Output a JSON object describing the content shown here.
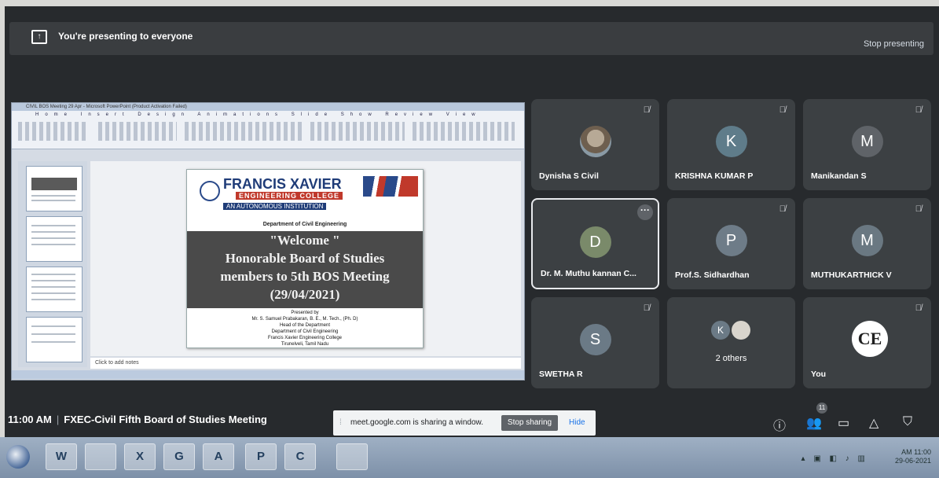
{
  "banner": {
    "presenting_text": "You're presenting to everyone",
    "stop_label": "Stop presenting"
  },
  "shared_window": {
    "title": "CIVIL BOS Meeting 29 Apr - Microsoft PowerPoint (Product Activation Failed)",
    "tabs": "Home Insert Design Animations Slide Show Review View",
    "notes_placeholder": "Click to add notes",
    "slide": {
      "college": "FRANCIS XAVIER",
      "college_sub": "ENGINEERING COLLEGE",
      "tagline": "AN AUTONOMOUS INSTITUTION",
      "department": "Department of Civil Engineering",
      "welcome": "\"Welcome \"",
      "line2": "Honorable Board of Studies",
      "line3": "members to 5th BOS Meeting",
      "date": "(29/04/2021)",
      "presenter_label": "Presented by",
      "presenter": "Mr. S. Samuel Prabakaran, B. E., M. Tech., (Ph. D)",
      "role": "Head of the Department",
      "dept": "Department of Civil Engineering",
      "college_full": "Francis Xavier Engineering College",
      "place": "Tirunelveli, Tamil Nadu"
    }
  },
  "participants": [
    {
      "name": "Dynisha S Civil",
      "initial": "",
      "color": "",
      "photo": true,
      "muted": true
    },
    {
      "name": "KRISHNA KUMAR P",
      "initial": "K",
      "color": "#5f7c8a",
      "photo": false,
      "muted": true
    },
    {
      "name": "Manikandan S",
      "initial": "M",
      "color": "#5f6368",
      "photo": false,
      "muted": true
    },
    {
      "name": "Dr. M. Muthu kannan C...",
      "initial": "D",
      "color": "#7a8a6a",
      "photo": false,
      "muted": false,
      "active": true
    },
    {
      "name": "Prof.S. Sidhardhan",
      "initial": "P",
      "color": "#6e7c88",
      "photo": false,
      "muted": true
    },
    {
      "name": "MUTHUKARTHICK V",
      "initial": "M",
      "color": "#6a7882",
      "photo": false,
      "muted": true
    },
    {
      "name": "SWETHA R",
      "initial": "S",
      "color": "#6b7a86",
      "photo": false,
      "muted": true
    },
    {
      "name": "",
      "others_label": "2 others",
      "initial": "K",
      "muted": false
    },
    {
      "name": "You",
      "initial": "CE",
      "muted": true
    }
  ],
  "meeting": {
    "time": "11:00 AM",
    "separator": "|",
    "title": "FXEC-Civil Fifth Board of Studies Meeting"
  },
  "share_notice": {
    "message": "meet.google.com is sharing a window.",
    "stop_label": "Stop sharing",
    "hide_label": "Hide"
  },
  "controls": {
    "participants_count": "11"
  },
  "taskbar": {
    "items": [
      "W",
      "",
      "X",
      "G",
      "A",
      "P",
      "C",
      ""
    ],
    "clock_time": "AM 11:00",
    "clock_date": "29-06-2021"
  },
  "icons": {
    "present": "present-icon",
    "mic_off": "mic-off-icon",
    "info": "info-icon",
    "people": "people-icon",
    "chat": "chat-icon",
    "activities": "activities-icon",
    "security": "shield-icon"
  }
}
